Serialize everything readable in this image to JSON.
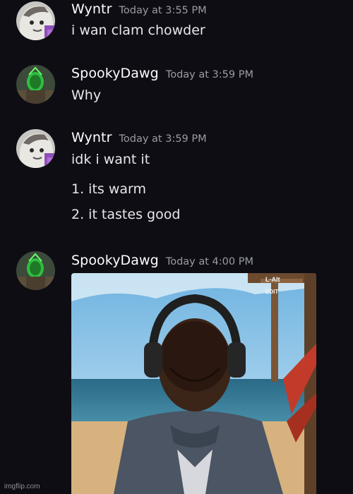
{
  "messages": [
    {
      "username": "Wyntr",
      "timestamp": "Today at 3:55 PM",
      "lines": [
        "i wan clam chowder"
      ],
      "avatar_icon": "wyntr-avatar-icon"
    },
    {
      "username": "SpookyDawg",
      "timestamp": "Today at 3:59 PM",
      "lines": [
        "Why"
      ],
      "avatar_icon": "spookydawg-avatar-icon"
    },
    {
      "username": "Wyntr",
      "timestamp": "Today at 3:59 PM",
      "lines": [
        "idk i want it",
        "1. its warm",
        "2. it tastes good"
      ],
      "avatar_icon": "wyntr-avatar-icon"
    },
    {
      "username": "SpookyDawg",
      "timestamp": "Today at 4:00 PM",
      "lines": [],
      "avatar_icon": "spookydawg-avatar-icon",
      "attachment": {
        "kind": "image",
        "overlay_text": [
          "L-Alt",
          "EDIT"
        ]
      }
    }
  ],
  "watermark": "imgflip.com",
  "colors": {
    "background": "#0e0d14",
    "username": "#ffffff",
    "timestamp": "#9a9ca3",
    "message_text": "#e6e7ea"
  }
}
